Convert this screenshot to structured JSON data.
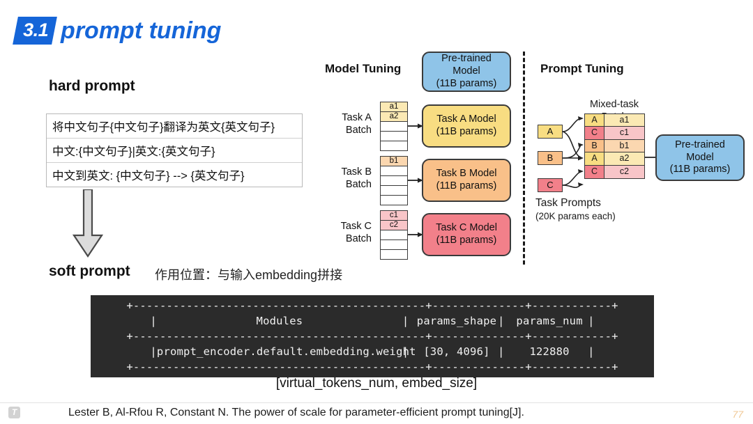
{
  "slide": {
    "number": "3.1",
    "title": "prompt tuning",
    "accent_color": "#1565d8"
  },
  "hard_prompt": {
    "label": "hard prompt",
    "rows": [
      "将中文句子{中文句子}翻译为英文{英文句子}",
      "中文:{中文句子}|英文:{英文句子}",
      "中文到英文: {中文句子} --> {英文句子}"
    ]
  },
  "arrow": {
    "icon": "down-block-arrow"
  },
  "soft_prompt": {
    "label": "soft prompt",
    "note": "作用位置：与输入embedding拼接"
  },
  "model_tuning": {
    "title": "Model Tuning",
    "pretrained_model": {
      "line1": "Pre-trained",
      "line2": "Model",
      "line3": "(11B params)",
      "color": "#8fc4e8"
    },
    "tasks": [
      {
        "batch_label_line1": "Task A",
        "batch_label_line2": "Batch",
        "cells": [
          "a1",
          "a2",
          "",
          "",
          ""
        ],
        "cell_color": "#fbe9b4",
        "model_line1": "Task A Model",
        "model_line2": "(11B params)",
        "model_color": "#f8dd82"
      },
      {
        "batch_label_line1": "Task B",
        "batch_label_line2": "Batch",
        "cells": [
          "b1",
          "",
          "",
          "",
          ""
        ],
        "cell_color": "#fbd7b0",
        "model_line1": "Task B Model",
        "model_line2": "(11B params)",
        "model_color": "#f9c089"
      },
      {
        "batch_label_line1": "Task C",
        "batch_label_line2": "Batch",
        "cells": [
          "c1",
          "c2",
          "",
          "",
          ""
        ],
        "cell_color": "#f8c5c8",
        "model_line1": "Task C Model",
        "model_line2": "(11B params)",
        "model_color": "#f2808a"
      }
    ]
  },
  "prompt_tuning": {
    "title": "Prompt Tuning",
    "mixed_batch_label_line1": "Mixed-task",
    "mixed_batch_label_line2": "Batch",
    "task_prompts_line1": "Task Prompts",
    "task_prompts_line2": "(20K params each)",
    "chips": [
      {
        "label": "A",
        "color": "#f8dd82"
      },
      {
        "label": "B",
        "color": "#f9c089"
      },
      {
        "label": "C",
        "color": "#f2808a"
      }
    ],
    "mixed_rows": [
      {
        "tag": "A",
        "item": "a1",
        "tag_color": "#f8dd82",
        "item_color": "#fbe9b4"
      },
      {
        "tag": "C",
        "item": "c1",
        "tag_color": "#f2808a",
        "item_color": "#f8c5c8"
      },
      {
        "tag": "B",
        "item": "b1",
        "tag_color": "#f9c089",
        "item_color": "#fbd7b0"
      },
      {
        "tag": "A",
        "item": "a2",
        "tag_color": "#f8dd82",
        "item_color": "#fbe9b4"
      },
      {
        "tag": "C",
        "item": "c2",
        "tag_color": "#f2808a",
        "item_color": "#f8c5c8"
      }
    ],
    "pretrained_model": {
      "line1": "Pre-trained",
      "line2": "Model",
      "line3": "(11B params)",
      "color": "#8fc4e8"
    }
  },
  "code_table": {
    "border_line": "+--------------------------------------------+--------------+------------+",
    "header": {
      "col1": "Modules",
      "col2": "params_shape",
      "col3": "params_num"
    },
    "row": {
      "col1": "prompt_encoder.default.embedding.weight",
      "col2": "[30, 4096]",
      "col3": "122880"
    },
    "caption": "[virtual_tokens_num, embed_size]",
    "background": "#2b2b2b"
  },
  "footer": {
    "icon": "T",
    "citation": "Lester B, Al-Rfou R, Constant N. The power of scale for parameter-efficient prompt tuning[J].",
    "page": "77"
  }
}
